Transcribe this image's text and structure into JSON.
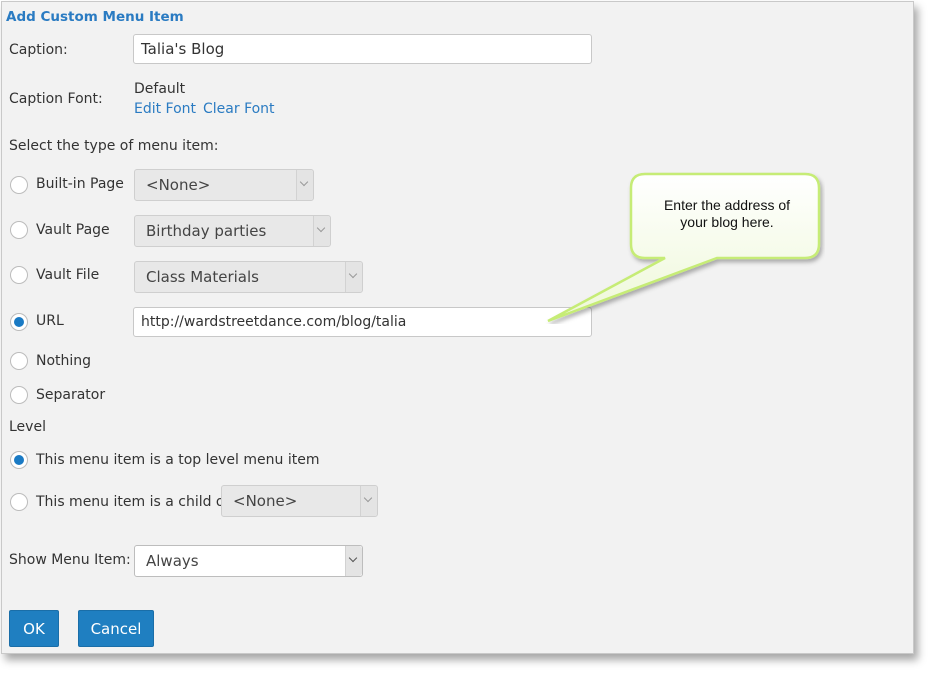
{
  "dialog": {
    "title": "Add Custom Menu Item",
    "caption_label": "Caption:",
    "caption_value": "Talia's Blog",
    "caption_font_label": "Caption Font:",
    "caption_font_value": "Default",
    "edit_font_link": "Edit Font",
    "clear_font_link": "Clear Font",
    "type_prompt": "Select the type of menu item:",
    "types": {
      "builtin": {
        "label": "Built-in Page",
        "selected_value": "<None>"
      },
      "vault_page": {
        "label": "Vault Page",
        "selected_value": "Birthday parties"
      },
      "vault_file": {
        "label": "Vault File",
        "selected_value": "Class Materials"
      },
      "url": {
        "label": "URL",
        "value": "http://wardstreetdance.com/blog/talia"
      },
      "nothing": {
        "label": "Nothing"
      },
      "separator": {
        "label": "Separator"
      }
    },
    "level_label": "Level",
    "level_top_label": "This menu item is a top level menu item",
    "level_child_label": "This menu item is a child of",
    "level_child_value": "<None>",
    "show_label": "Show Menu Item:",
    "show_value": "Always",
    "ok_label": "OK",
    "cancel_label": "Cancel"
  },
  "callout": {
    "text_line1": "Enter the address of",
    "text_line2": "your blog here."
  },
  "colors": {
    "accent": "#1f7fc1",
    "link": "#2a7bc2",
    "panel": "#f2f2f2",
    "callout_border": "#c6ec76"
  }
}
